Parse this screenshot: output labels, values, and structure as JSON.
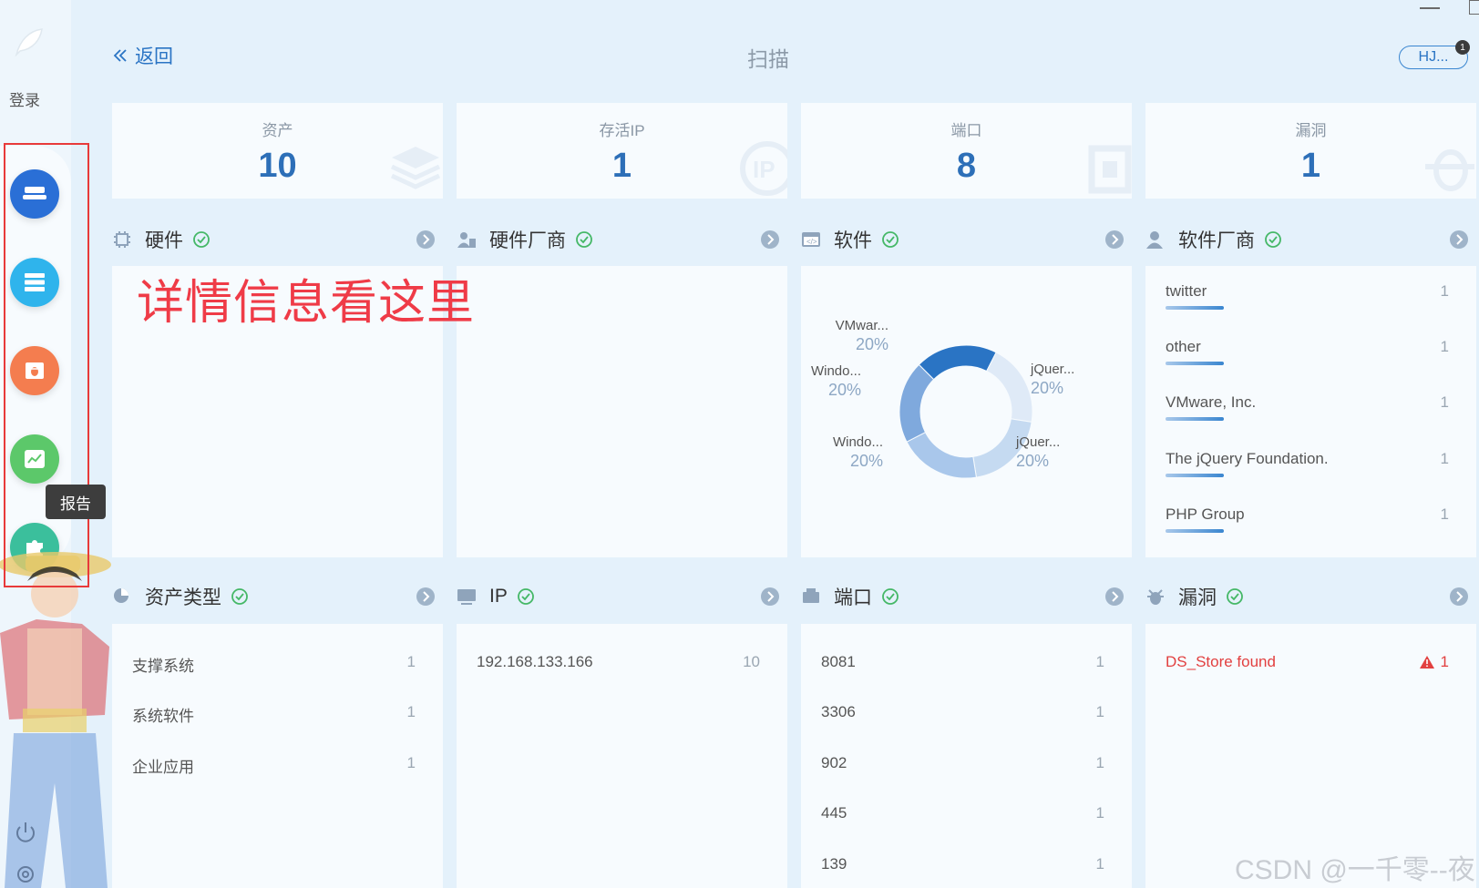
{
  "window": {
    "minimize_icon": "minimize-icon",
    "maximize_icon": "maximize-icon"
  },
  "sidebar": {
    "login_label": "登录",
    "tooltip": "报告",
    "buttons": [
      {
        "name": "assets",
        "color": "#2a6fd6"
      },
      {
        "name": "services",
        "color": "#2fb4ec"
      },
      {
        "name": "vulnerabilities",
        "color": "#f47d4f"
      },
      {
        "name": "report",
        "color": "#5cc86a"
      },
      {
        "name": "plugins",
        "color": "#3bbf9c"
      }
    ]
  },
  "header": {
    "back_label": "返回",
    "title": "扫描",
    "user": "HJ...",
    "badge": "1"
  },
  "stats": [
    {
      "label": "资产",
      "value": "10"
    },
    {
      "label": "存活IP",
      "value": "1"
    },
    {
      "label": "端口",
      "value": "8"
    },
    {
      "label": "漏洞",
      "value": "1"
    }
  ],
  "sections": {
    "hardware": {
      "title": "硬件"
    },
    "hardware_vendor": {
      "title": "硬件厂商"
    },
    "software": {
      "title": "软件"
    },
    "software_vendor": {
      "title": "软件厂商"
    },
    "asset_type": {
      "title": "资产类型"
    },
    "ip": {
      "title": "IP"
    },
    "port": {
      "title": "端口"
    },
    "vuln": {
      "title": "漏洞"
    }
  },
  "annotation": "详情信息看这里",
  "chart_data": {
    "type": "pie",
    "donut": true,
    "slices": [
      {
        "label": "VMwar...",
        "pct": "20%",
        "value": 20,
        "color": "#2a74c4"
      },
      {
        "label": "jQuer...",
        "pct": "20%",
        "value": 20,
        "color": "#dfeaf7"
      },
      {
        "label": "jQuer...",
        "pct": "20%",
        "value": 20,
        "color": "#c5daf1"
      },
      {
        "label": "Windo...",
        "pct": "20%",
        "value": 20,
        "color": "#a9c7eb"
      },
      {
        "label": "Windo...",
        "pct": "20%",
        "value": 20,
        "color": "#7fa9dd"
      }
    ]
  },
  "software_vendors": [
    {
      "name": "twitter",
      "count": "1"
    },
    {
      "name": "other",
      "count": "1"
    },
    {
      "name": "VMware, Inc.",
      "count": "1"
    },
    {
      "name": "The jQuery Foundation.",
      "count": "1"
    },
    {
      "name": "PHP Group",
      "count": "1"
    }
  ],
  "asset_types": [
    {
      "name": "支撑系统",
      "count": "1"
    },
    {
      "name": "系统软件",
      "count": "1"
    },
    {
      "name": "企业应用",
      "count": "1"
    }
  ],
  "ips": [
    {
      "name": "192.168.133.166",
      "count": "10"
    }
  ],
  "ports": [
    {
      "name": "8081",
      "count": "1"
    },
    {
      "name": "3306",
      "count": "1"
    },
    {
      "name": "902",
      "count": "1"
    },
    {
      "name": "445",
      "count": "1"
    },
    {
      "name": "139",
      "count": "1"
    }
  ],
  "vulns": [
    {
      "name": "DS_Store found",
      "count": "1"
    }
  ],
  "watermark": "CSDN @一千零--夜"
}
